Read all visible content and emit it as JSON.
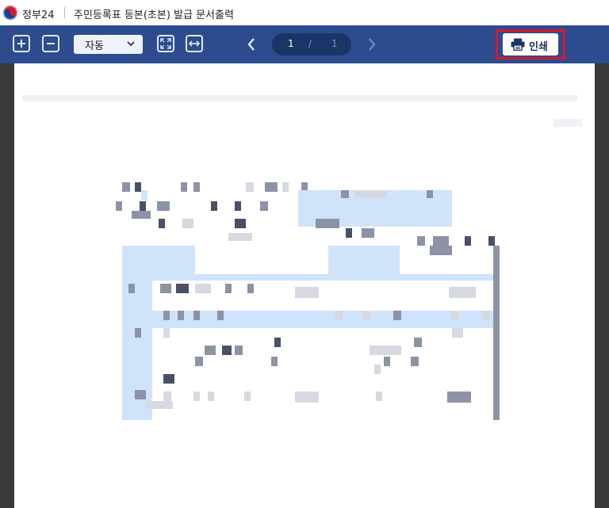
{
  "app": {
    "brand": "정부24",
    "document_title": "주민등록표 등본(초본) 발급 문서출력"
  },
  "toolbar": {
    "zoom_in_icon": "plus-square-icon",
    "zoom_out_icon": "minus-square-icon",
    "zoom_value": "자동",
    "fit_page_icon": "expand-icon",
    "fit_width_icon": "fit-width-icon",
    "current_page": "1",
    "page_separator": "/",
    "total_pages": "1",
    "print_label": "인쇄",
    "print_icon": "printer-icon"
  },
  "colors": {
    "toolbar_bg": "#2d4c8f",
    "pager_bg": "#1d3467",
    "highlight": "#d6192c"
  }
}
